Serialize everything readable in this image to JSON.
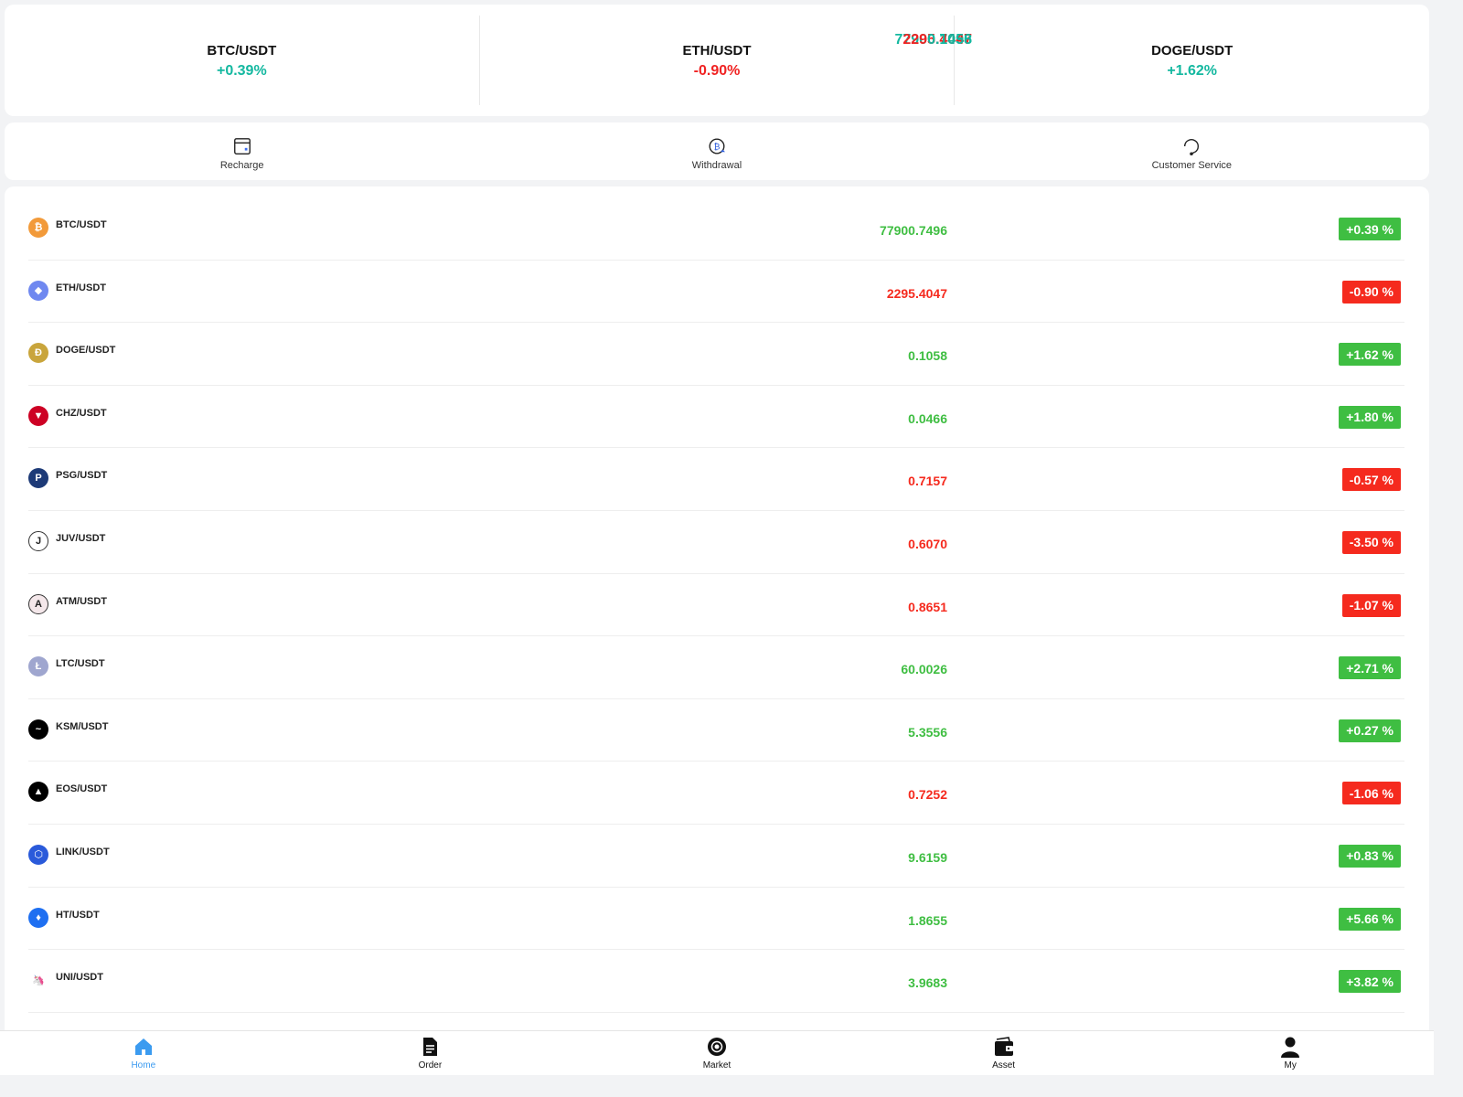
{
  "tickers": [
    {
      "symbol": "BTC/USDT",
      "price": "77900.7496",
      "change": "+0.39%",
      "trend": "up"
    },
    {
      "symbol": "ETH/USDT",
      "price": "2295.4047",
      "change": "-0.90%",
      "trend": "down"
    },
    {
      "symbol": "DOGE/USDT",
      "price": "0.1058",
      "change": "+1.62%",
      "trend": "up"
    }
  ],
  "actions": {
    "recharge": "Recharge",
    "withdrawal": "Withdrawal",
    "customer_service": "Customer Service"
  },
  "market": [
    {
      "pair": "BTC/USDT",
      "price": "77900.7496",
      "change": "+0.39 %",
      "trend": "up",
      "icon": "btc-icon",
      "icon_color": "#f29a3a",
      "glyph": "₿"
    },
    {
      "pair": "ETH/USDT",
      "price": "2295.4047",
      "change": "-0.90 %",
      "trend": "down",
      "icon": "eth-icon",
      "icon_color": "#6f88f0",
      "glyph": "◆"
    },
    {
      "pair": "DOGE/USDT",
      "price": "0.1058",
      "change": "+1.62 %",
      "trend": "up",
      "icon": "doge-icon",
      "icon_color": "#c9a53c",
      "glyph": "Ð"
    },
    {
      "pair": "CHZ/USDT",
      "price": "0.0466",
      "change": "+1.80 %",
      "trend": "up",
      "icon": "chz-icon",
      "icon_color": "#cd0124",
      "glyph": "▼"
    },
    {
      "pair": "PSG/USDT",
      "price": "0.7157",
      "change": "-0.57 %",
      "trend": "down",
      "icon": "psg-icon",
      "icon_color": "#1d3a77",
      "glyph": "P"
    },
    {
      "pair": "JUV/USDT",
      "price": "0.6070",
      "change": "-3.50 %",
      "trend": "down",
      "icon": "juv-icon",
      "icon_color": "#ffffff",
      "glyph": "J"
    },
    {
      "pair": "ATM/USDT",
      "price": "0.8651",
      "change": "-1.07 %",
      "trend": "down",
      "icon": "atm-icon",
      "icon_color": "#f4e7ea",
      "glyph": "A"
    },
    {
      "pair": "LTC/USDT",
      "price": "60.0026",
      "change": "+2.71 %",
      "trend": "up",
      "icon": "ltc-icon",
      "icon_color": "#9fa6cf",
      "glyph": "Ł"
    },
    {
      "pair": "KSM/USDT",
      "price": "5.3556",
      "change": "+0.27 %",
      "trend": "up",
      "icon": "ksm-icon",
      "icon_color": "#000000",
      "glyph": "~"
    },
    {
      "pair": "EOS/USDT",
      "price": "0.7252",
      "change": "-1.06 %",
      "trend": "down",
      "icon": "eos-icon",
      "icon_color": "#000000",
      "glyph": "▲"
    },
    {
      "pair": "LINK/USDT",
      "price": "9.6159",
      "change": "+0.83 %",
      "trend": "up",
      "icon": "link-icon",
      "icon_color": "#2a5ada",
      "glyph": "⬡"
    },
    {
      "pair": "HT/USDT",
      "price": "1.8655",
      "change": "+5.66 %",
      "trend": "up",
      "icon": "ht-icon",
      "icon_color": "#1e6ff1",
      "glyph": "♦"
    },
    {
      "pair": "UNI/USDT",
      "price": "3.9683",
      "change": "+3.82 %",
      "trend": "up",
      "icon": "uni-icon",
      "icon_color": "#ffffff",
      "glyph": "🦄"
    }
  ],
  "tabs": [
    {
      "label": "Home",
      "icon": "home-icon",
      "active": true
    },
    {
      "label": "Order",
      "icon": "order-icon",
      "active": false
    },
    {
      "label": "Market",
      "icon": "market-icon",
      "active": false
    },
    {
      "label": "Asset",
      "icon": "wallet-icon",
      "active": false
    },
    {
      "label": "My",
      "icon": "user-icon",
      "active": false
    }
  ],
  "colors": {
    "up": "#3fbe42",
    "down": "#f52a1e",
    "ticker_up": "#14b8a0",
    "active_tab": "#3b9bf0"
  }
}
